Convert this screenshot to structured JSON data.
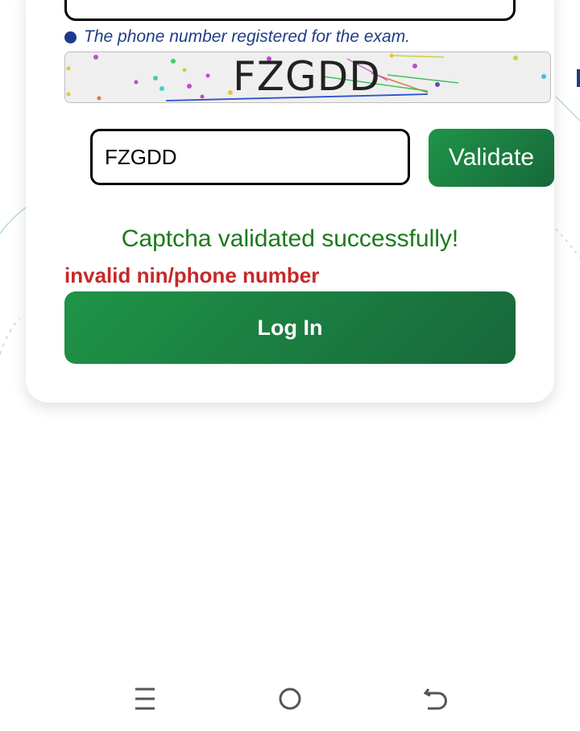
{
  "form": {
    "phone_hint": "The phone number registered for the exam.",
    "captcha_text": "FZGDD",
    "captcha_input_value": "FZGDD",
    "validate_label": "Validate",
    "success_message": "Captcha validated successfully!",
    "error_message": "invalid nin/phone number",
    "login_label": "Log In"
  },
  "colors": {
    "primary_green": "#1f8f45",
    "success_text": "#1c7a1c",
    "error_text": "#c62828",
    "hint_text": "#1f3d86"
  },
  "navbar": {
    "icons": [
      "menu-icon",
      "home-icon",
      "back-icon"
    ]
  }
}
